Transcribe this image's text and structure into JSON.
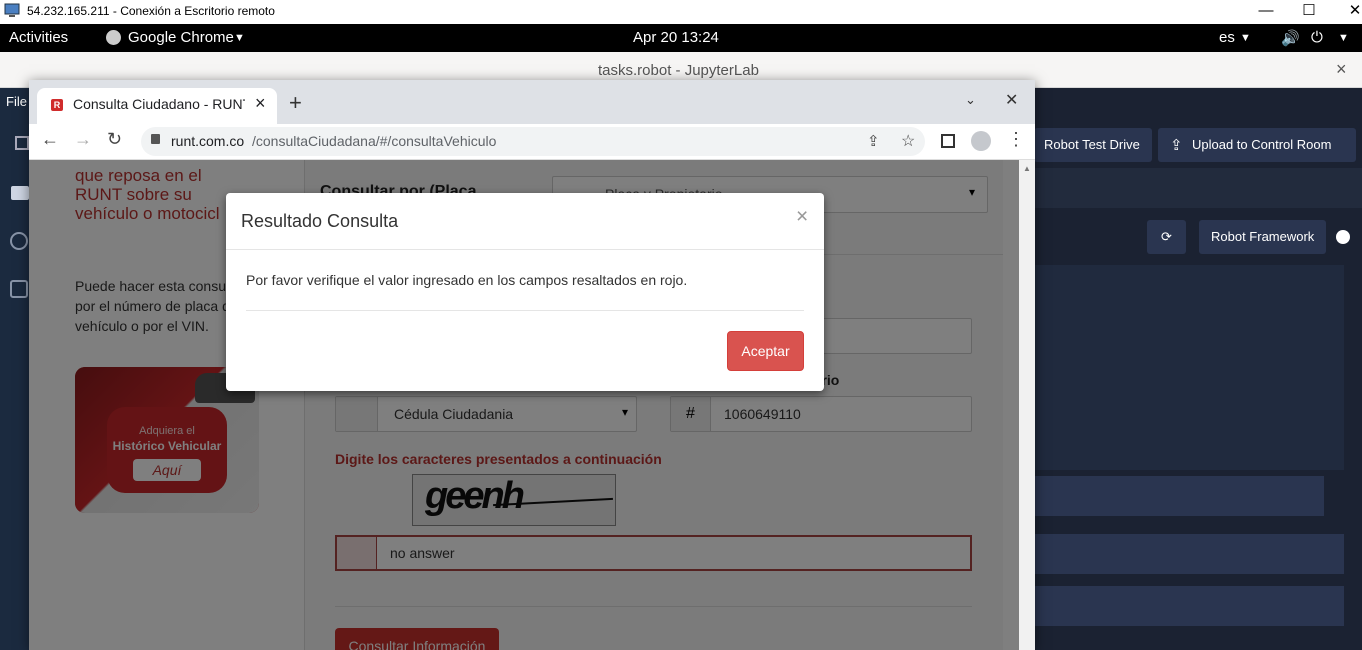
{
  "rdp": {
    "title": "54.232.165.211 - Conexión a Escritorio remoto",
    "minimize": "—",
    "maximize": "☐",
    "close": "✕"
  },
  "gnome": {
    "activities": "Activities",
    "app": "Google Chrome",
    "clock": "Apr 20  13:24",
    "lang": "es"
  },
  "jupyter": {
    "title": "tasks.robot - JupyterLab",
    "close": "×",
    "menu_file": "File",
    "robot_test_drive": "Robot Test Drive",
    "upload": "Upload to Control Room",
    "kernel": "Robot Framework"
  },
  "chrome": {
    "tab_title": "Consulta Ciudadano - RUNT",
    "new_tab": "+",
    "tab_close": "×",
    "url_host": "runt.com.co",
    "url_path": "/consultaCiudadana/#/consultaVehiculo"
  },
  "page": {
    "sidebar_title_l1": "que reposa en el",
    "sidebar_title_l2": "RUNT sobre su",
    "sidebar_title_l3": "vehículo o motocicl",
    "sidebar_text_l1": "Puede hacer esta consu",
    "sidebar_text_l2": "por el número de placa d",
    "sidebar_text_l3": "vehículo o por el VIN.",
    "banner_l1": "Adquiera el",
    "banner_l2": "Histórico Vehicular",
    "banner_btn": "Aquí",
    "consultar_por": "Consultar por (Placa",
    "select_placa": "Placa y Propietario",
    "label_owner": "tario",
    "doc_type": "Cédula Ciudadania",
    "doc_number": "1060649110",
    "captcha_label": "Digite los caracteres presentados a continuación",
    "captcha_img_text": "geenh",
    "captcha_value": "no answer",
    "submit": "Consultar Información"
  },
  "modal": {
    "title": "Resultado Consulta",
    "close": "×",
    "message": "Por favor verifique el valor ingresado en los campos resaltados en rojo.",
    "accept": "Aceptar"
  },
  "colors": {
    "runt_red": "#b8312f",
    "accept_btn": "#d9534f",
    "jupyter_dark": "#1b2232"
  }
}
